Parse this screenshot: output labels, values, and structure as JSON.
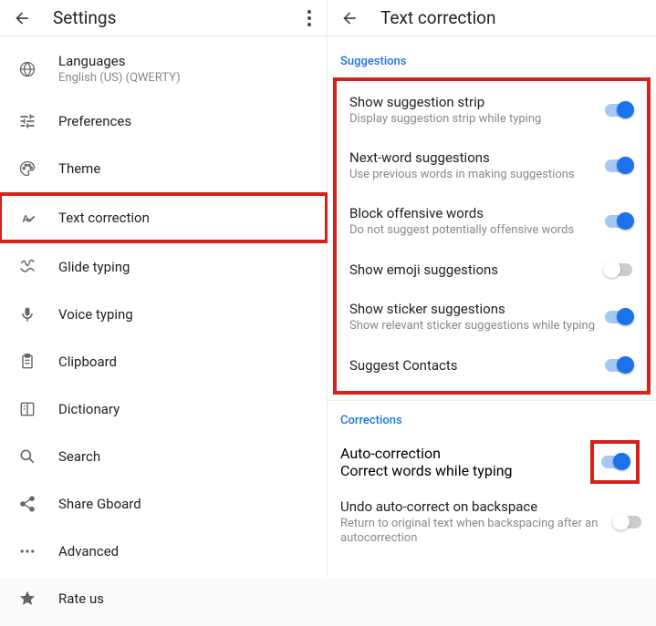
{
  "left": {
    "headerTitle": "Settings",
    "items": [
      {
        "label": "Languages",
        "sub": "English (US) (QWERTY)"
      },
      {
        "label": "Preferences"
      },
      {
        "label": "Theme"
      },
      {
        "label": "Text correction",
        "highlight": true
      },
      {
        "label": "Glide typing"
      },
      {
        "label": "Voice typing"
      },
      {
        "label": "Clipboard"
      },
      {
        "label": "Dictionary"
      },
      {
        "label": "Search"
      },
      {
        "label": "Share Gboard"
      },
      {
        "label": "Advanced"
      },
      {
        "label": "Rate us"
      }
    ]
  },
  "right": {
    "headerTitle": "Text correction",
    "sectionSuggestions": "Suggestions",
    "sectionCorrections": "Corrections",
    "suggestions": [
      {
        "title": "Show suggestion strip",
        "sub": "Display suggestion strip while typing",
        "on": true
      },
      {
        "title": "Next-word suggestions",
        "sub": "Use previous words in making suggestions",
        "on": true
      },
      {
        "title": "Block offensive words",
        "sub": "Do not suggest potentially offensive words",
        "on": true
      },
      {
        "title": "Show emoji suggestions",
        "sub": "",
        "on": false
      },
      {
        "title": "Show sticker suggestions",
        "sub": "Show relevant sticker suggestions while typing",
        "on": true
      },
      {
        "title": "Suggest Contacts",
        "sub": "",
        "on": true
      }
    ],
    "autoCorrection": {
      "title": "Auto-correction",
      "sub": "Correct words while typing",
      "on": true
    },
    "undoAuto": {
      "title": "Undo auto-correct on backspace",
      "sub": "Return to original text when backspacing after an autocorrection",
      "on": false
    }
  }
}
